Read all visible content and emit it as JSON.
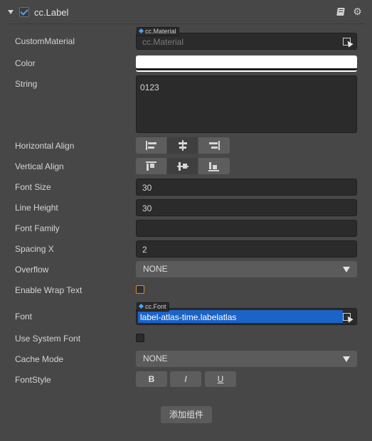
{
  "component": {
    "title": "cc.Label",
    "enabled": true
  },
  "custom_material": {
    "label": "CustomMaterial",
    "type_tag": "cc.Material",
    "value": "cc.Material"
  },
  "color": {
    "label": "Color",
    "value": "#ffffff"
  },
  "string": {
    "label": "String",
    "value": "0123"
  },
  "horizontal_align": {
    "label": "Horizontal Align",
    "options": [
      "left",
      "center",
      "right"
    ],
    "selected": "center"
  },
  "vertical_align": {
    "label": "Vertical Align",
    "options": [
      "top",
      "center",
      "bottom"
    ],
    "selected": "center"
  },
  "font_size": {
    "label": "Font Size",
    "value": "30"
  },
  "line_height": {
    "label": "Line Height",
    "value": "30"
  },
  "font_family": {
    "label": "Font Family",
    "value": ""
  },
  "spacing_x": {
    "label": "Spacing X",
    "value": "2"
  },
  "overflow": {
    "label": "Overflow",
    "value": "NONE"
  },
  "enable_wrap_text": {
    "label": "Enable Wrap Text",
    "checked": false,
    "highlight_color": "#e08a2e"
  },
  "font": {
    "label": "Font",
    "type_tag": "cc.Font",
    "value": "label-atlas-time.labelatlas",
    "selection_color": "#1c63c8"
  },
  "use_system_font": {
    "label": "Use System Font",
    "checked": false
  },
  "cache_mode": {
    "label": "Cache Mode",
    "value": "NONE"
  },
  "font_style": {
    "label": "FontStyle",
    "bold": "B",
    "italic": "I",
    "underline": "U"
  },
  "add_component": {
    "label": "添加组件"
  }
}
